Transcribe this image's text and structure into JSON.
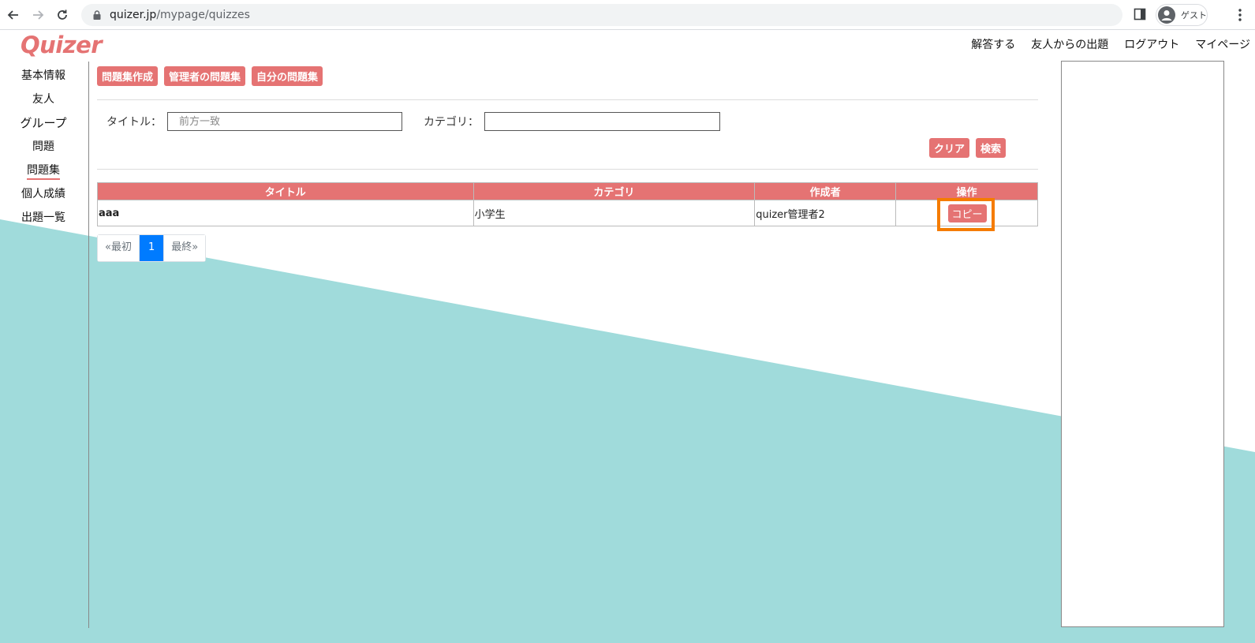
{
  "browser": {
    "url_host": "quizer.jp",
    "url_path": "/mypage/quizzes",
    "profile_label": "ゲスト"
  },
  "site": {
    "logo": "Quizer",
    "nav": [
      "解答する",
      "友人からの出題",
      "ログアウト",
      "マイページ"
    ]
  },
  "sidebar": {
    "items": [
      {
        "label": "基本情報"
      },
      {
        "label": "友人"
      },
      {
        "label": "グループ"
      },
      {
        "label": "問題"
      },
      {
        "label": "問題集",
        "active": true
      },
      {
        "label": "個人成績"
      },
      {
        "label": "出題一覧"
      }
    ]
  },
  "main": {
    "tabs": [
      "問題集作成",
      "管理者の問題集",
      "自分の問題集"
    ],
    "search": {
      "title_label": "タイトル：",
      "title_placeholder": "前方一致",
      "title_value": "",
      "category_label": "カテゴリ：",
      "category_value": ""
    },
    "clear_label": "クリア",
    "search_label": "検索",
    "table": {
      "headers": [
        "タイトル",
        "カテゴリ",
        "作成者",
        "操作"
      ],
      "rows": [
        {
          "title": "aaa",
          "category": "小学生",
          "author": "quizer管理者2",
          "action": "コピー"
        }
      ]
    },
    "pagination": {
      "first": "«最初",
      "current": "1",
      "last": "最終»"
    }
  },
  "colors": {
    "accent": "#e57373",
    "teal_background": "#a0dbdb",
    "highlight": "#f57c00",
    "pager_active": "#007bff"
  }
}
